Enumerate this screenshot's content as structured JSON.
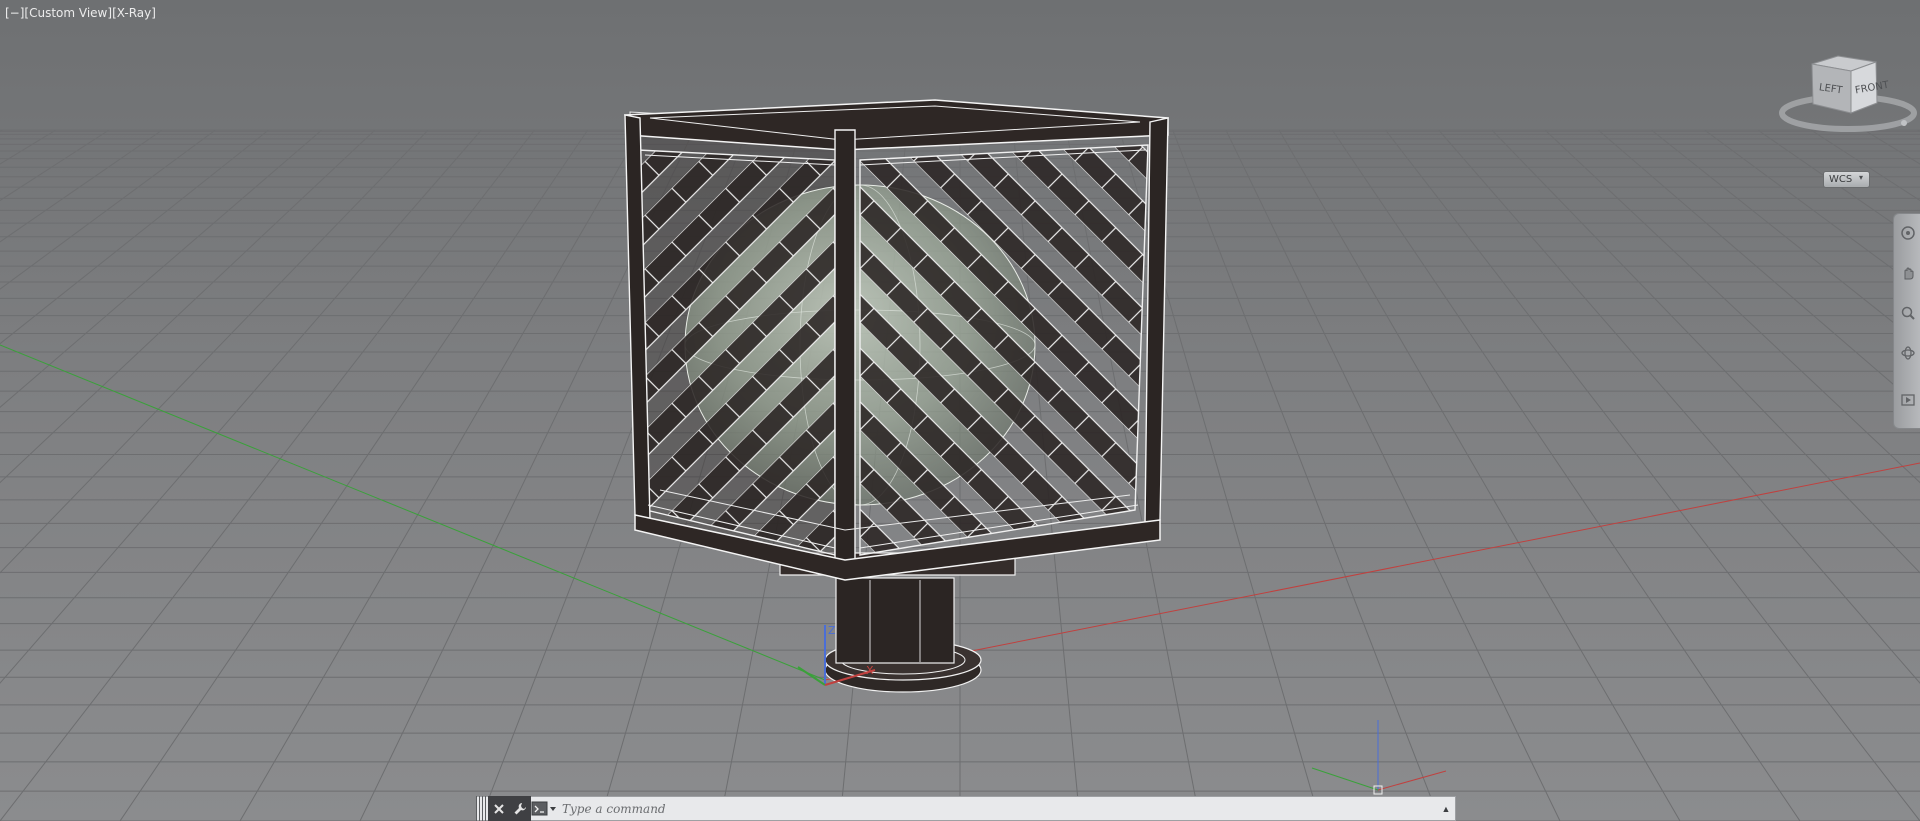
{
  "viewport": {
    "label_parts": [
      "[−]",
      "[Custom View]",
      "[X-Ray]"
    ],
    "visual_style": "X-Ray"
  },
  "viewcube": {
    "left_face": "LEFT",
    "front_face": "FRONT"
  },
  "ucs_menu": {
    "label": "WCS",
    "chevron": "▾"
  },
  "navigation_bar": {
    "items": [
      "steering-wheel-icon",
      "pan-icon",
      "zoom-icon",
      "orbit-icon",
      "showmotion-icon"
    ]
  },
  "command_line": {
    "placeholder": "Type a command",
    "history_arrow": "▲"
  },
  "colors": {
    "background": "#7e7f81",
    "grid_line": "#6d6e70",
    "x_axis": "#c0413f",
    "y_axis": "#3aa13a",
    "z_axis": "#4a6ed8",
    "edge": "#f2f2f2"
  }
}
